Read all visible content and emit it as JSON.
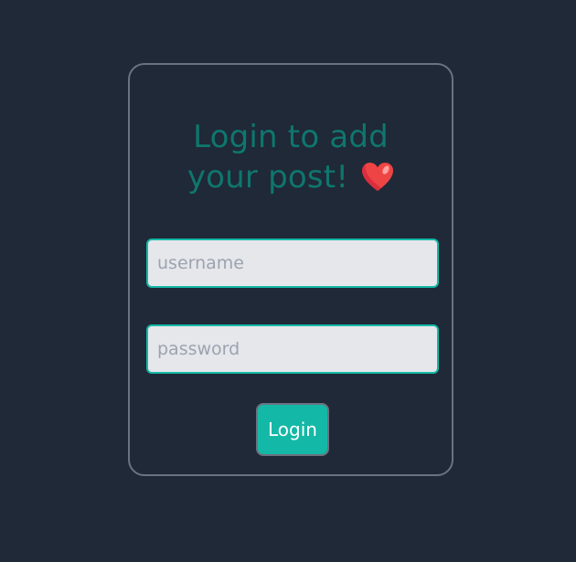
{
  "login_card": {
    "title_line1": "Login to add",
    "title_line2": "your post!",
    "title_icon": "heart-icon",
    "username": {
      "value": "",
      "placeholder": "username"
    },
    "password": {
      "value": "",
      "placeholder": "password"
    },
    "login_label": "Login"
  },
  "colors": {
    "background": "#1f2937",
    "card_border": "#6b7280",
    "title": "#0f766e",
    "accent": "#14b8a6",
    "input_background": "#e5e7eb",
    "heart": "#ef4444"
  }
}
